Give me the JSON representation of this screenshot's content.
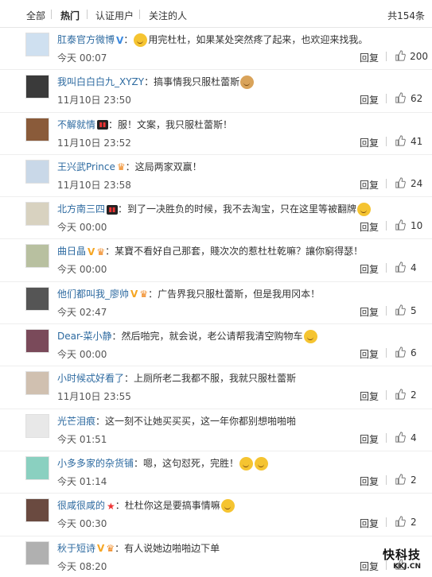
{
  "tabs": [
    {
      "label": "全部",
      "active": false
    },
    {
      "label": "热门",
      "active": true
    },
    {
      "label": "认证用户",
      "active": false
    },
    {
      "label": "关注的人",
      "active": false
    }
  ],
  "total_label": "共154条",
  "reply_label": "回复",
  "comments": [
    {
      "user": "肛泰官方微博",
      "badges": [
        "verified-blue"
      ],
      "text": "：",
      "emoji_before": "cat",
      "text2": "用完杜杜，如果某处突然疼了起来，也欢迎来找我。",
      "time": "今天 00:07",
      "likes": "200",
      "avatar_color": "#cfe0f0"
    },
    {
      "user": "我叫白白白九_XYZY",
      "badges": [],
      "text": "：搞事情我只服杜蕾斯",
      "emoji_after": "dog",
      "time": "11月10日 23:50",
      "likes": "62",
      "avatar_color": "#3a3a3a"
    },
    {
      "user": "不解就情",
      "badges": [
        "vip-black"
      ],
      "text": "：服！文案，我只服杜蕾斯！",
      "time": "11月10日 23:52",
      "likes": "41",
      "avatar_color": "#8a5b3a"
    },
    {
      "user": "王兴武Prince",
      "badges": [
        "crown"
      ],
      "text": "：这局两家双赢！",
      "time": "11月10日 23:58",
      "likes": "24",
      "avatar_color": "#c9d8e8"
    },
    {
      "user": "北方南三四",
      "badges": [
        "vip-black"
      ],
      "text": "：到了一决胜负的时候，我不去淘宝，只在这里等被翻牌",
      "emoji_after": "cat",
      "time": "今天 00:00",
      "likes": "10",
      "avatar_color": "#d8d2c0"
    },
    {
      "user": "曲日晶",
      "badges": [
        "verified-gold",
        "crown"
      ],
      "text": "：某寶不看好自己那套，賤次次的惹杜杜乾嘛？讓你窮得瑟！",
      "time": "今天 00:00",
      "likes": "4",
      "avatar_color": "#b8c0a0"
    },
    {
      "user": "他们都叫我_廖帅",
      "badges": [
        "verified-gold",
        "crown"
      ],
      "text": "：广告界我只服杜蕾斯，但是我用冈本！",
      "time": "今天 02:47",
      "likes": "5",
      "avatar_color": "#555555"
    },
    {
      "user": "Dear-菜小静",
      "badges": [],
      "text": "：然后啪完，就会说，老公请帮我清空购物车",
      "emoji_after": "laugh",
      "time": "今天 00:00",
      "likes": "6",
      "avatar_color": "#7a4a5a"
    },
    {
      "user": "小时候忒好看了",
      "badges": [],
      "text": "：上厕所老二我都不服，我就只服杜蕾斯",
      "time": "11月10日 23:55",
      "likes": "2",
      "avatar_color": "#d0c0b0"
    },
    {
      "user": "光芒泪痕",
      "badges": [],
      "text": "：这一刻不让她买买买，这一年你都别想啪啪啪",
      "time": "今天 01:51",
      "likes": "4",
      "avatar_color": "#e8e8e8"
    },
    {
      "user": "小多多家的杂货铺",
      "badges": [],
      "text": "：嗯，这句怼死，完胜！",
      "emoji_after": "laugh",
      "emoji_after2": "laugh",
      "time": "今天 01:14",
      "likes": "2",
      "avatar_color": "#8ad0c0"
    },
    {
      "user": "很咸很咸的",
      "badges": [
        "vip-red"
      ],
      "text": "：杜杜你这是要搞事情嘛",
      "emoji_after": "cat",
      "time": "今天 00:30",
      "likes": "2",
      "avatar_color": "#6a4a40"
    },
    {
      "user": "秋于短诗",
      "badges": [
        "verified-gold",
        "crown"
      ],
      "text": "：有人说她边啪啪边下单",
      "time": "今天 08:20",
      "likes": "",
      "avatar_color": "#b0b0b0"
    }
  ],
  "watermark": {
    "text": "快科技",
    "url": "KKJ.CN"
  }
}
